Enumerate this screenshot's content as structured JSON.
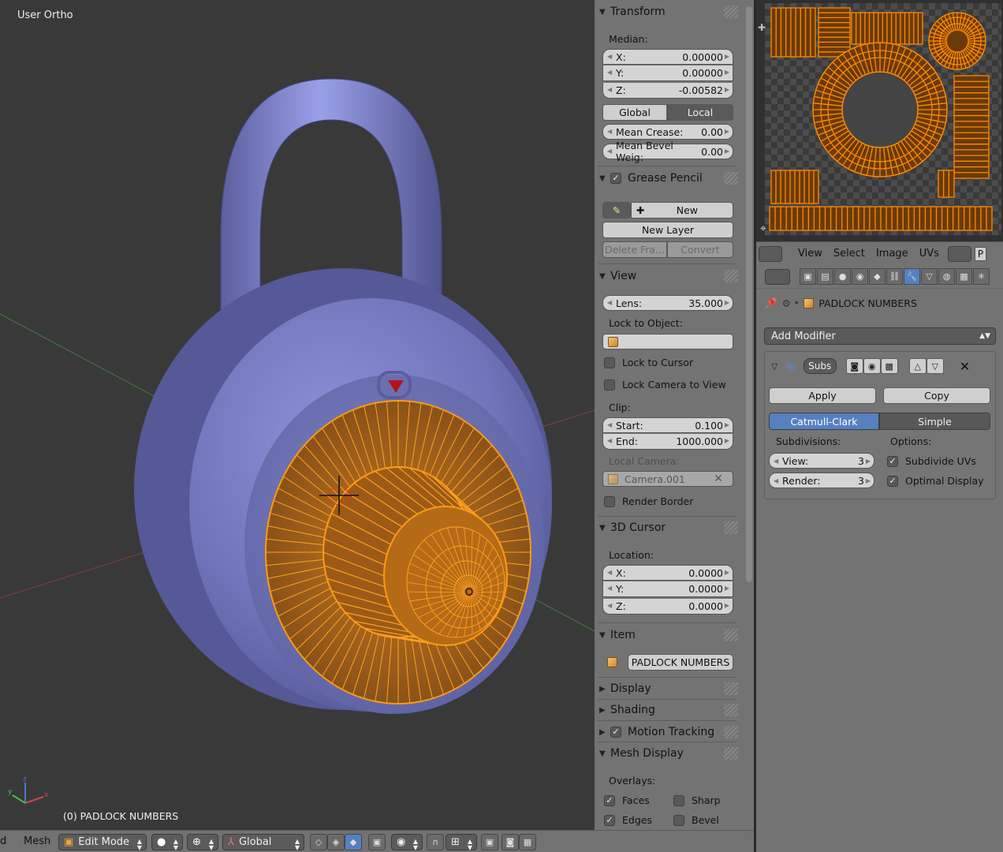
{
  "viewport": {
    "title": "User Ortho",
    "object_label": "(0) PADLOCK NUMBERS",
    "axes": {
      "x": "x",
      "y": "y",
      "z": "z"
    }
  },
  "npanel": {
    "transform": {
      "header": "Transform",
      "median_label": "Median:",
      "x": {
        "label": "X:",
        "value": "0.00000"
      },
      "y": {
        "label": "Y:",
        "value": "0.00000"
      },
      "z": {
        "label": "Z:",
        "value": "-0.00582"
      },
      "global_label": "Global",
      "local_label": "Local",
      "mean_crease": {
        "label": "Mean Crease:",
        "value": "0.00"
      },
      "mean_bevel": {
        "label": "Mean Bevel Weig:",
        "value": "0.00"
      }
    },
    "grease_pencil": {
      "header": "Grease Pencil",
      "new_label": "New",
      "new_layer_label": "New Layer",
      "delete_frame_label": "Delete Fra...",
      "convert_label": "Convert"
    },
    "view": {
      "header": "View",
      "lens": {
        "label": "Lens:",
        "value": "35.000"
      },
      "lock_to_object_label": "Lock to Object:",
      "lock_to_cursor_label": "Lock to Cursor",
      "lock_camera_label": "Lock Camera to View",
      "clip_label": "Clip:",
      "start": {
        "label": "Start:",
        "value": "0.100"
      },
      "end": {
        "label": "End:",
        "value": "1000.000"
      },
      "local_camera_label": "Local Camera:",
      "camera_value": "Camera.001",
      "render_border_label": "Render Border"
    },
    "cursor3d": {
      "header": "3D Cursor",
      "location_label": "Location:",
      "x": {
        "label": "X:",
        "value": "0.0000"
      },
      "y": {
        "label": "Y:",
        "value": "0.0000"
      },
      "z": {
        "label": "Z:",
        "value": "0.0000"
      }
    },
    "item": {
      "header": "Item",
      "name": "PADLOCK NUMBERS"
    },
    "display": {
      "header": "Display"
    },
    "shading": {
      "header": "Shading"
    },
    "motion_tracking": {
      "header": "Motion Tracking"
    },
    "mesh_display": {
      "header": "Mesh Display",
      "overlays_label": "Overlays:",
      "faces_label": "Faces",
      "sharp_label": "Sharp",
      "edges_label": "Edges",
      "bevel_label": "Bevel"
    }
  },
  "uv_header": {
    "view": "View",
    "select": "Select",
    "image": "Image",
    "uvs": "UVs",
    "trunc": "P"
  },
  "properties": {
    "context_object": "PADLOCK NUMBERS",
    "add_modifier_label": "Add Modifier",
    "modifier": {
      "name": "Subs",
      "apply_label": "Apply",
      "copy_label": "Copy",
      "catmull_label": "Catmull-Clark",
      "simple_label": "Simple",
      "subdivisions_label": "Subdivisions:",
      "options_label": "Options:",
      "view": {
        "label": "View:",
        "value": "3"
      },
      "render": {
        "label": "Render:",
        "value": "3"
      },
      "subdivide_uvs_label": "Subdivide UVs",
      "optimal_display_label": "Optimal Display"
    }
  },
  "bottom": {
    "edge_char": "d",
    "mesh_menu": "Mesh",
    "mode_label": "Edit Mode",
    "orientation_label": "Global"
  },
  "colors": {
    "accent_blue": "#5680c2",
    "mesh_orange": "#ff8a00",
    "padlock_body": "#6f74b8"
  }
}
